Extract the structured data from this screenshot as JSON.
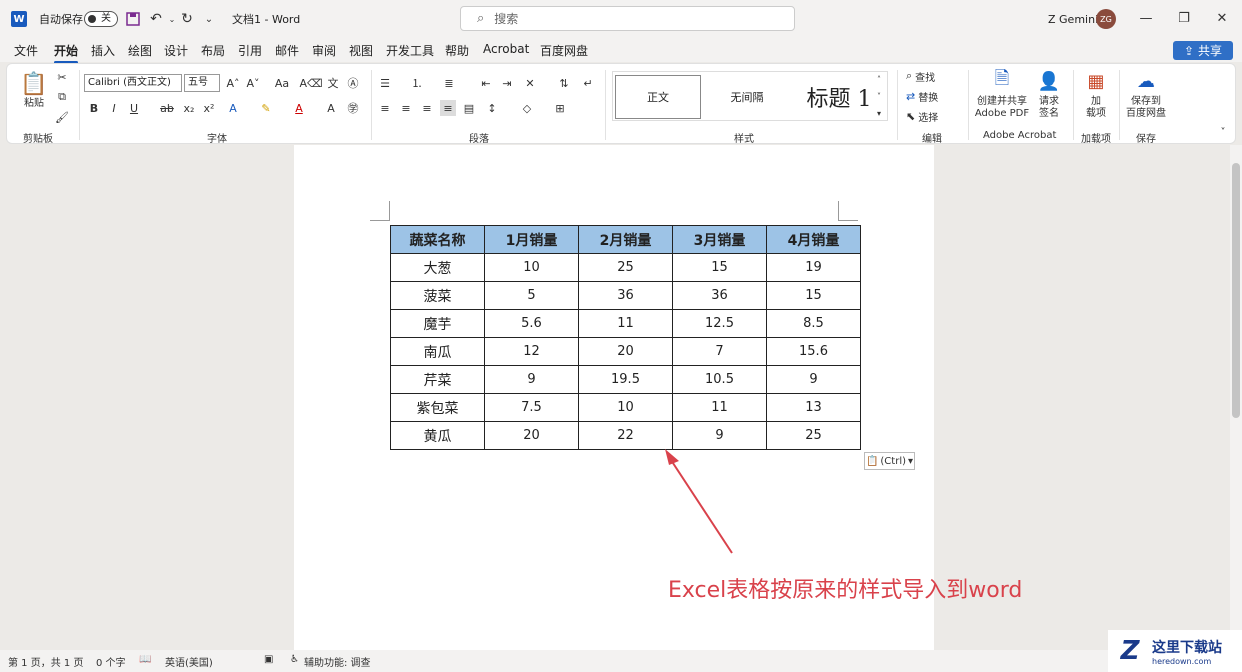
{
  "titlebar": {
    "autosave_label": "自动保存",
    "autosave_state": "关",
    "doc_title": "文档1  -  Word",
    "search_placeholder": "搜索",
    "user_name": "Z Gemini",
    "user_initials": "ZG"
  },
  "menu": {
    "items": [
      "文件",
      "开始",
      "插入",
      "绘图",
      "设计",
      "布局",
      "引用",
      "邮件",
      "审阅",
      "视图",
      "开发工具",
      "帮助",
      "Acrobat",
      "百度网盘"
    ],
    "active": "开始",
    "share_label": "共享"
  },
  "ribbon": {
    "clipboard": {
      "paste_label": "粘贴",
      "group_label": "剪贴板"
    },
    "font": {
      "font_name": "Calibri (西文正文)",
      "font_size": "五号",
      "group_label": "字体"
    },
    "paragraph": {
      "group_label": "段落"
    },
    "styles": {
      "items": [
        "正文",
        "无间隔",
        "标题 1"
      ],
      "group_label": "样式"
    },
    "editing": {
      "find": "查找",
      "replace": "替换",
      "select": "选择",
      "group_label": "编辑"
    },
    "acrobat": {
      "create_share": "创建并共享",
      "adobe_pdf": "Adobe PDF",
      "request": "请求",
      "sign": "签名",
      "group_label": "Adobe Acrobat"
    },
    "addins": {
      "add": "加",
      "items": "载项",
      "group_label": "加载项"
    },
    "save": {
      "save_to": "保存到",
      "baidu": "百度网盘",
      "group_label": "保存"
    }
  },
  "table": {
    "headers": [
      "蔬菜名称",
      "1月销量",
      "2月销量",
      "3月销量",
      "4月销量"
    ],
    "rows": [
      [
        "大葱",
        "10",
        "25",
        "15",
        "19"
      ],
      [
        "菠菜",
        "5",
        "36",
        "36",
        "15"
      ],
      [
        "魔芋",
        "5.6",
        "11",
        "12.5",
        "8.5"
      ],
      [
        "南瓜",
        "12",
        "20",
        "7",
        "15.6"
      ],
      [
        "芹菜",
        "9",
        "19.5",
        "10.5",
        "9"
      ],
      [
        "紫包菜",
        "7.5",
        "10",
        "11",
        "13"
      ],
      [
        "黄瓜",
        "20",
        "22",
        "9",
        "25"
      ]
    ],
    "header_color": "#9dc3e6"
  },
  "paste_options_label": "(Ctrl)",
  "annotation": "Excel表格按原来的样式导入到word",
  "status": {
    "page": "第 1 页，共 1 页",
    "words": "0 个字",
    "language": "英语(美国)",
    "accessibility": "辅助功能: 调查"
  },
  "watermark": {
    "cn": "这里下载站",
    "en": "heredown.com"
  },
  "colors": {
    "accent": "#185abd",
    "annotation": "#d9424b",
    "share": "#2f6fc6"
  }
}
